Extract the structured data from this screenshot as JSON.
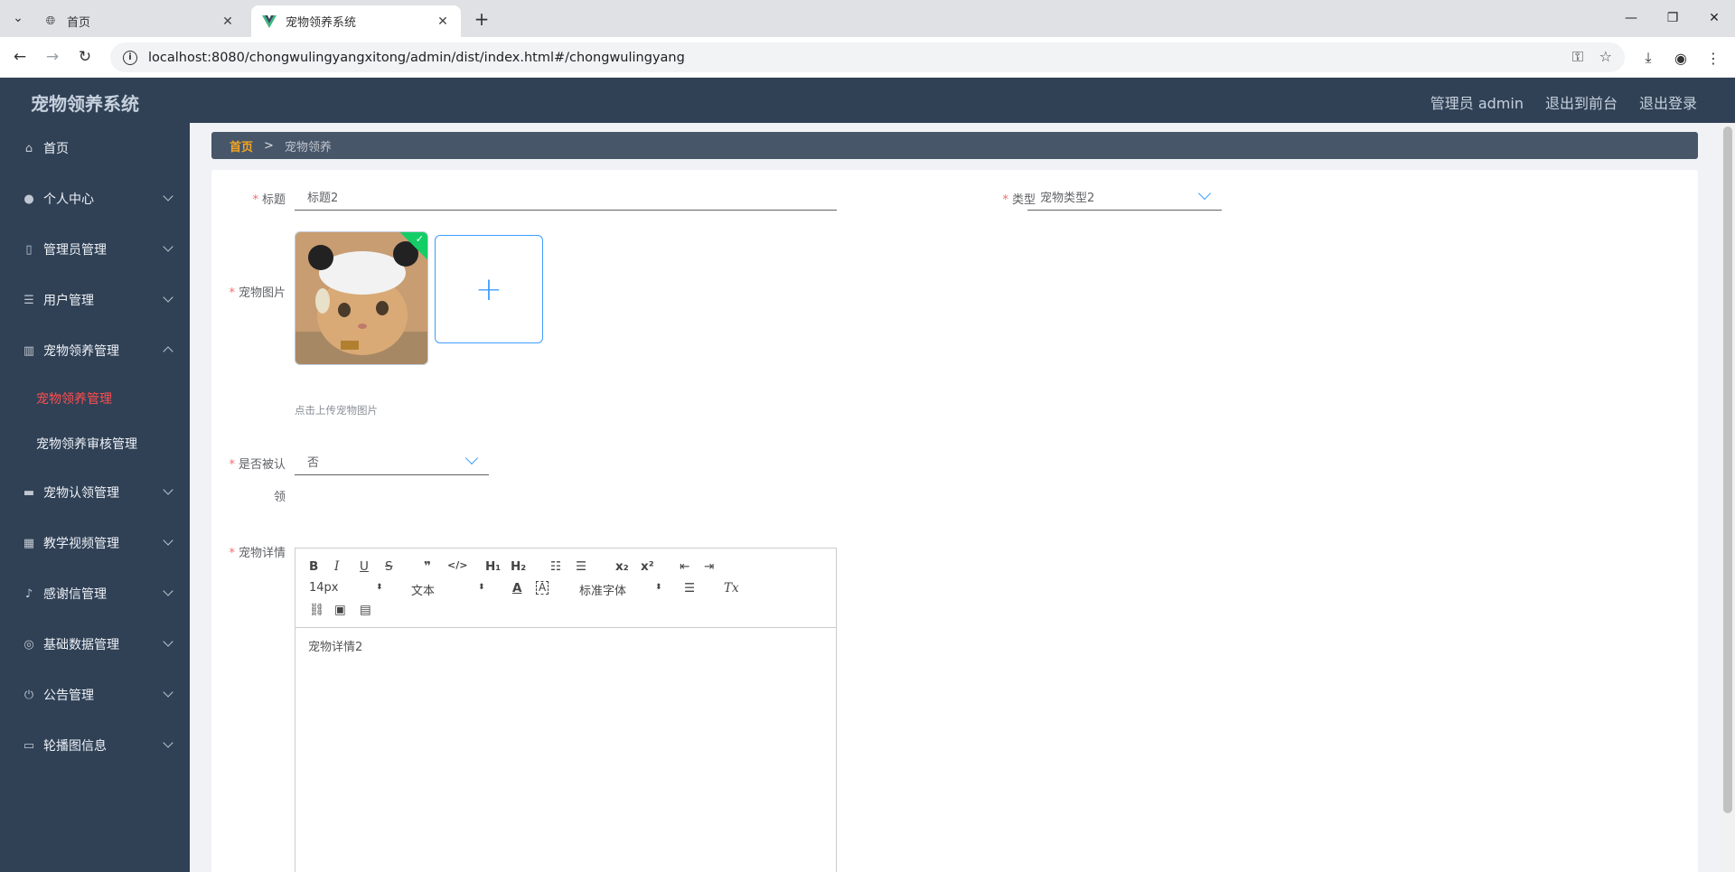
{
  "browser": {
    "tabs": [
      {
        "title": "首页",
        "active": false
      },
      {
        "title": "宠物领养系统",
        "active": true
      }
    ],
    "url": "localhost:8080/chongwulingyangxitong/admin/dist/index.html#/chongwulingyang",
    "new_tab": "+",
    "controls": {
      "minimize": "—",
      "restore": "❐",
      "close": "✕"
    }
  },
  "header": {
    "app_title": "宠物领养系统",
    "links": [
      "管理员 admin",
      "退出到前台",
      "退出登录"
    ]
  },
  "sidebar": {
    "items": [
      {
        "label": "首页",
        "icon": "home-icon",
        "glyph": "⌂"
      },
      {
        "label": "个人中心",
        "icon": "user-icon",
        "glyph": "●"
      },
      {
        "label": "管理员管理",
        "icon": "mobile-icon",
        "glyph": "▯"
      },
      {
        "label": "用户管理",
        "icon": "list-icon",
        "glyph": "☰"
      },
      {
        "label": "宠物领养管理",
        "icon": "chart-icon",
        "glyph": "▥"
      },
      {
        "label": "宠物认领管理",
        "icon": "monitor-icon",
        "glyph": "▬"
      },
      {
        "label": "教学视频管理",
        "icon": "grid-icon",
        "glyph": "▦"
      },
      {
        "label": "感谢信管理",
        "icon": "microphone-icon",
        "glyph": "♪"
      },
      {
        "label": "基础数据管理",
        "icon": "settings-icon",
        "glyph": "◎"
      },
      {
        "label": "公告管理",
        "icon": "power-icon",
        "glyph": "⏻"
      },
      {
        "label": "轮播图信息",
        "icon": "chat-icon",
        "glyph": "▭"
      }
    ],
    "sub_items": [
      "宠物领养管理",
      "宠物领养审核管理"
    ]
  },
  "breadcrumb": {
    "home": "首页",
    "separator": ">",
    "current": "宠物领养"
  },
  "form": {
    "title_label": "标题",
    "title_value": "标题2",
    "type_label": "类型",
    "type_value": "宠物类型2",
    "image_label": "宠物图片",
    "upload_tip": "点击上传宠物图片",
    "adopted_label_1": "是否被认",
    "adopted_label_2": "领",
    "adopted_value": "否",
    "detail_label": "宠物详情",
    "detail_value": "宠物详情2",
    "editor": {
      "font_size": "14px",
      "paragraph": "文本",
      "font_family": "标准字体"
    }
  },
  "colors": {
    "sidebar_bg": "#304156",
    "active_menu": "#ff4d4f",
    "breadcrumb_home": "#f5a623",
    "required": "#f56c6c",
    "primary": "#409eff"
  }
}
